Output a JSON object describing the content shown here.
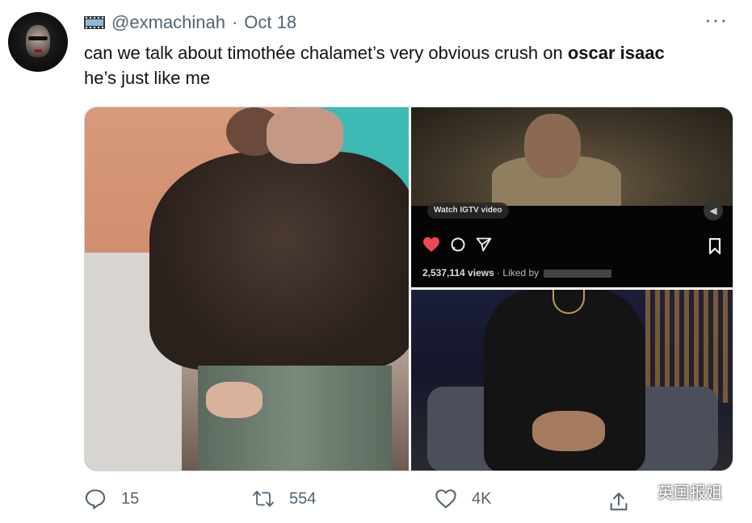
{
  "author": {
    "handle": "@exmachinah",
    "separator": "·",
    "date": "Oct 18"
  },
  "more_label": "···",
  "tweet": {
    "line1_prefix": "can we talk about timothée chalamet’s very obvious crush on ",
    "line1_bold": "oscar isaac",
    "line2": "he’s just like me"
  },
  "media": {
    "ig_badge": "Watch IGTV video",
    "ig_views": "2,537,114 views",
    "ig_liked": "· Liked by"
  },
  "actions": {
    "reply_count": "15",
    "retweet_count": "554",
    "like_count": "4K"
  },
  "watermark": "英国报姐",
  "colors": {
    "secondary_text": "#536471",
    "primary_text": "#0f1419",
    "ig_heart": "#ed4956"
  }
}
